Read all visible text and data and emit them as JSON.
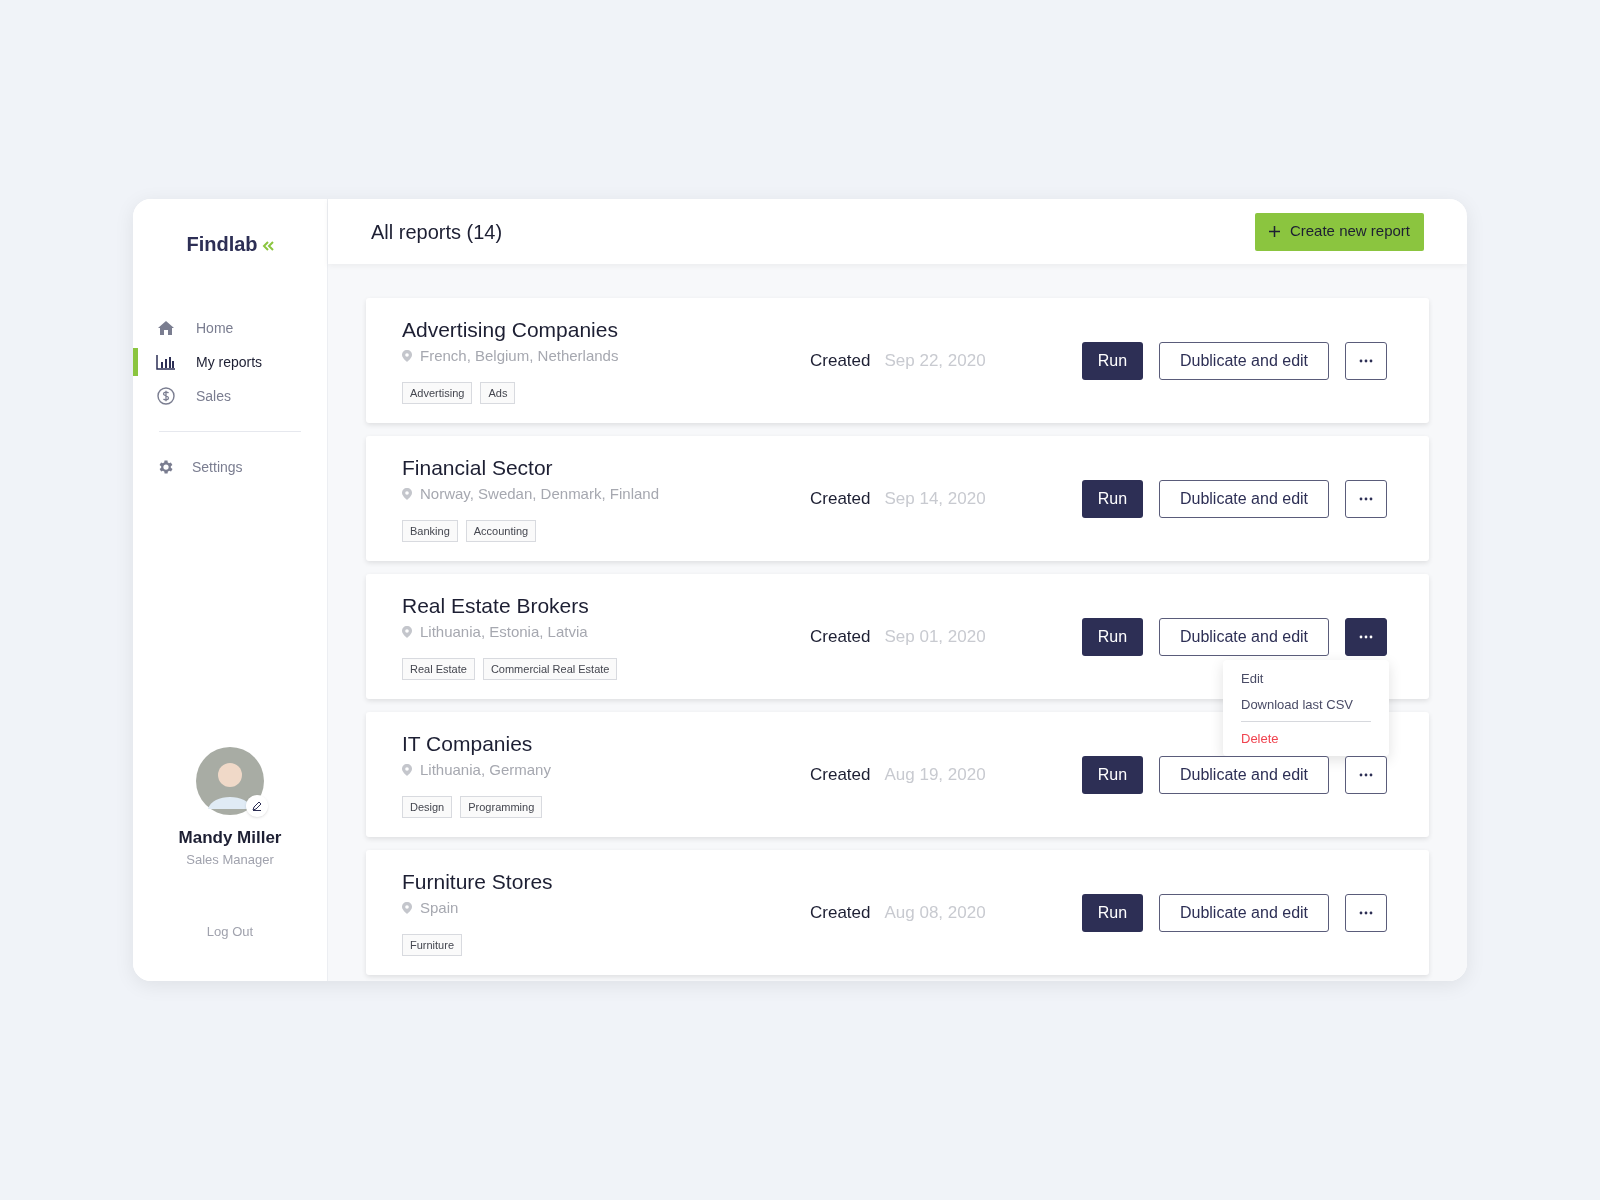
{
  "brand": {
    "name": "Findlab"
  },
  "nav": [
    {
      "label": "Home",
      "kind": "home",
      "selected": false
    },
    {
      "label": "My reports",
      "kind": "chart",
      "selected": true
    },
    {
      "label": "Sales",
      "kind": "dollar",
      "selected": false
    }
  ],
  "nav_secondary": [
    {
      "label": "Settings",
      "kind": "gear",
      "selected": false
    }
  ],
  "user": {
    "name": "Mandy Miller",
    "role": "Sales Manager"
  },
  "logout": "Log Out",
  "header": {
    "title": "All reports (14)",
    "create_button": "Create new report"
  },
  "reports": [
    {
      "title": "Advertising Companies",
      "locations": "French, Belgium, Netherlands",
      "tags": [
        "Advertising",
        "Ads"
      ],
      "created_label": "Created",
      "date": "Sep 22, 2020",
      "run": "Run",
      "duplicate": "Dublicate and edit",
      "menu_open": false
    },
    {
      "title": "Financial Sector",
      "locations": "Norway, Swedan, Denmark, Finland",
      "tags": [
        "Banking",
        "Accounting"
      ],
      "created_label": "Created",
      "date": "Sep 14, 2020",
      "run": "Run",
      "duplicate": "Dublicate and edit",
      "menu_open": false
    },
    {
      "title": "Real Estate Brokers",
      "locations": "Lithuania, Estonia, Latvia",
      "tags": [
        "Real Estate",
        "Commercial Real Estate"
      ],
      "created_label": "Created",
      "date": "Sep 01, 2020",
      "run": "Run",
      "duplicate": "Dublicate and edit",
      "menu_open": true
    },
    {
      "title": "IT Companies",
      "locations": "Lithuania, Germany",
      "tags": [
        "Design",
        "Programming"
      ],
      "created_label": "Created",
      "date": "Aug 19, 2020",
      "run": "Run",
      "duplicate": "Dublicate and edit",
      "menu_open": false
    },
    {
      "title": "Furniture Stores",
      "locations": "Spain",
      "tags": [
        "Furniture"
      ],
      "created_label": "Created",
      "date": "Aug 08, 2020",
      "run": "Run",
      "duplicate": "Dublicate and edit",
      "menu_open": false
    }
  ],
  "menu": [
    {
      "label": "Edit",
      "kind": "normal"
    },
    {
      "label": "Download last CSV",
      "kind": "normal"
    },
    {
      "label": "Delete",
      "kind": "danger"
    }
  ]
}
